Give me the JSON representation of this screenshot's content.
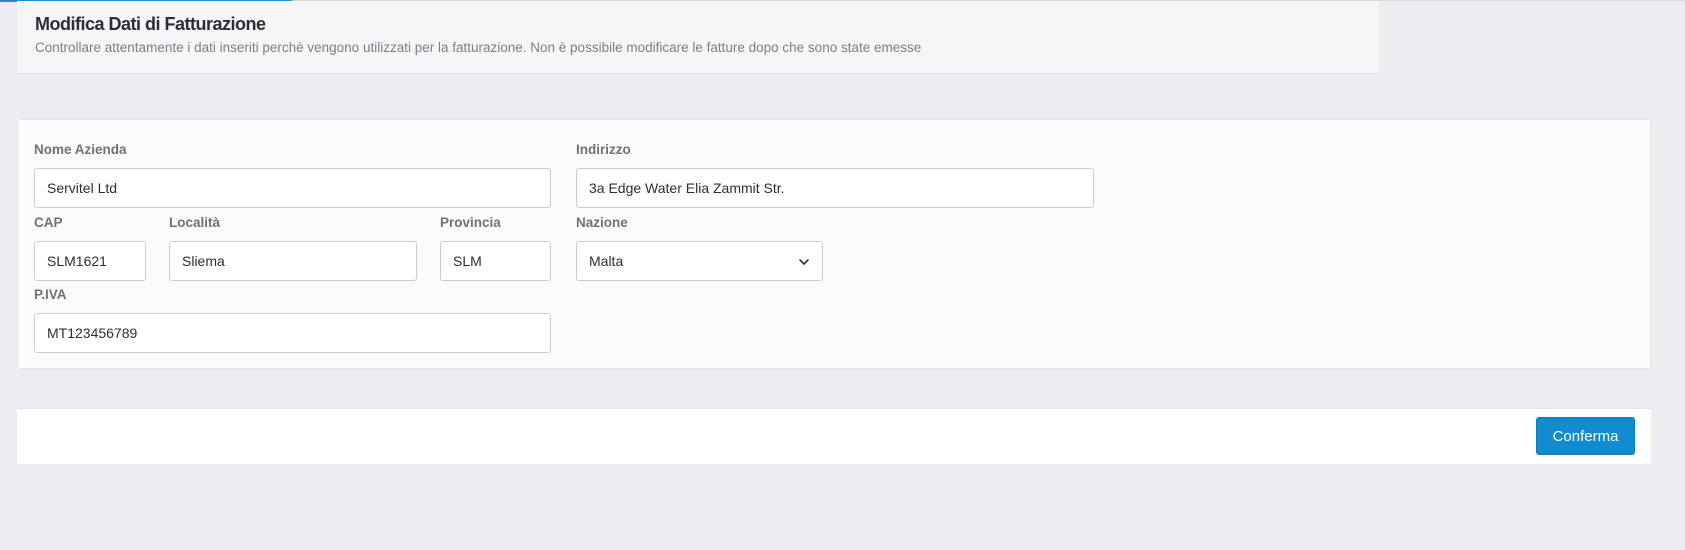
{
  "header": {
    "title": "Modifica Dati di Fatturazione",
    "subtitle": "Controllare attentamente i dati inseriti perchè vengono utilizzati per la fatturazione. Non è possibile modificare le fatture dopo che sono state emesse"
  },
  "form": {
    "company_name": {
      "label": "Nome Azienda",
      "value": "Servitel Ltd"
    },
    "address": {
      "label": "Indirizzo",
      "value": "3a Edge Water Elia Zammit Str."
    },
    "postal_code": {
      "label": "CAP",
      "value": "SLM1621"
    },
    "city": {
      "label": "Località",
      "value": "Sliema"
    },
    "province": {
      "label": "Provincia",
      "value": "SLM"
    },
    "country": {
      "label": "Nazione",
      "value": "Malta"
    },
    "vat": {
      "label": "P.IVA",
      "value": "MT123456789"
    }
  },
  "footer": {
    "confirm_label": "Conferma"
  },
  "colors": {
    "accent": "#138bd0",
    "background": "#ecedf0"
  },
  "icons": {
    "select_arrow": "chevron-down-icon"
  }
}
